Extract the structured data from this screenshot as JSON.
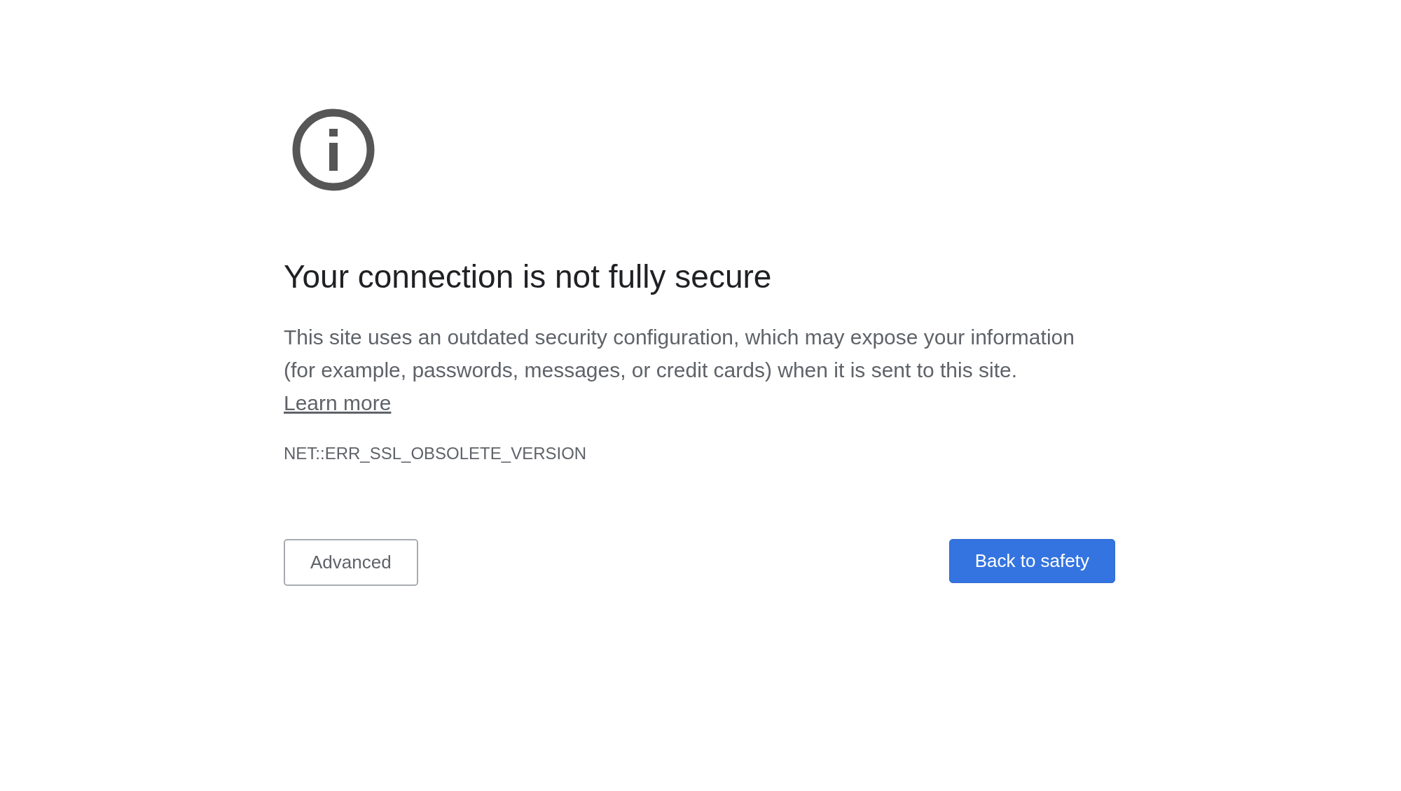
{
  "heading": "Your connection is not fully secure",
  "message": {
    "text": "This site uses an outdated security configuration, which may expose your information (for example, passwords, messages, or credit cards) when it is sent to this site.",
    "link": "Learn more"
  },
  "error_code": "NET::ERR_SSL_OBSOLETE_VERSION",
  "buttons": [
    {
      "label": "Advanced",
      "kind": "secondary"
    },
    {
      "label": "Back to safety",
      "kind": "primary"
    }
  ]
}
